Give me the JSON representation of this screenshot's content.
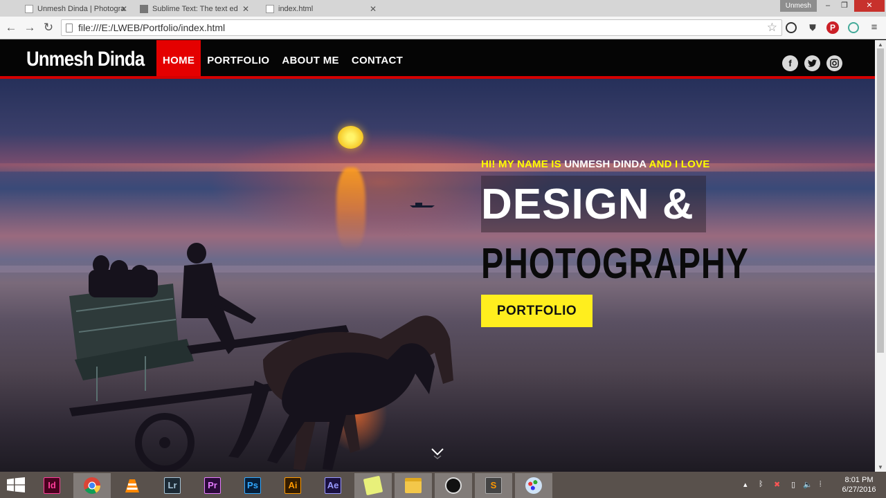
{
  "browser": {
    "tabs": [
      {
        "title": "Unmesh Dinda | Photogra",
        "active": true
      },
      {
        "title": "Sublime Text: The text ed",
        "active": false
      },
      {
        "title": "index.html",
        "active": false
      }
    ],
    "profile_name": "Unmesh",
    "address": "file:///E:/LWEB/Portfolio/index.html"
  },
  "site": {
    "logo": "Unmesh Dinda",
    "menu": [
      "HOME",
      "PORTFOLIO",
      "ABOUT ME",
      "CONTACT"
    ],
    "active_menu": "HOME",
    "social": [
      "facebook-icon",
      "twitter-icon",
      "instagram-icon"
    ],
    "hero": {
      "tagline_pre": "HI! MY NAME IS ",
      "tagline_name": "UNMESH DINDA",
      "tagline_post": " AND I LOVE",
      "headline_1": "DESIGN &",
      "headline_2": "PHOTOGRAPHY",
      "cta_label": "PORTFOLIO"
    }
  },
  "taskbar": {
    "apps": [
      {
        "label": "Id",
        "name": "indesign",
        "bg": "#49021f",
        "fg": "#ff3d9a"
      },
      {
        "label": "",
        "name": "chrome",
        "active": true
      },
      {
        "label": "",
        "name": "vlc"
      },
      {
        "label": "Lr",
        "name": "lightroom",
        "bg": "#1c2a35",
        "fg": "#a8c4d6"
      },
      {
        "label": "Pr",
        "name": "premiere",
        "bg": "#2a0a3a",
        "fg": "#e57bff"
      },
      {
        "label": "Ps",
        "name": "photoshop",
        "bg": "#061e3a",
        "fg": "#31a8ff"
      },
      {
        "label": "Ai",
        "name": "illustrator",
        "bg": "#331c00",
        "fg": "#ff9a00"
      },
      {
        "label": "Ae",
        "name": "after-effects",
        "bg": "#1a1040",
        "fg": "#9999ff"
      },
      {
        "label": "",
        "name": "sticky-notes"
      },
      {
        "label": "",
        "name": "file-explorer"
      },
      {
        "label": "",
        "name": "obs"
      },
      {
        "label": "S",
        "name": "sublime-text"
      },
      {
        "label": "",
        "name": "paint"
      }
    ],
    "time": "8:01 PM",
    "date": "6/27/2016"
  },
  "colors": {
    "nav_active": "#e40000",
    "accent_yellow": "#ffee1e",
    "nav_bg": "#050505"
  }
}
